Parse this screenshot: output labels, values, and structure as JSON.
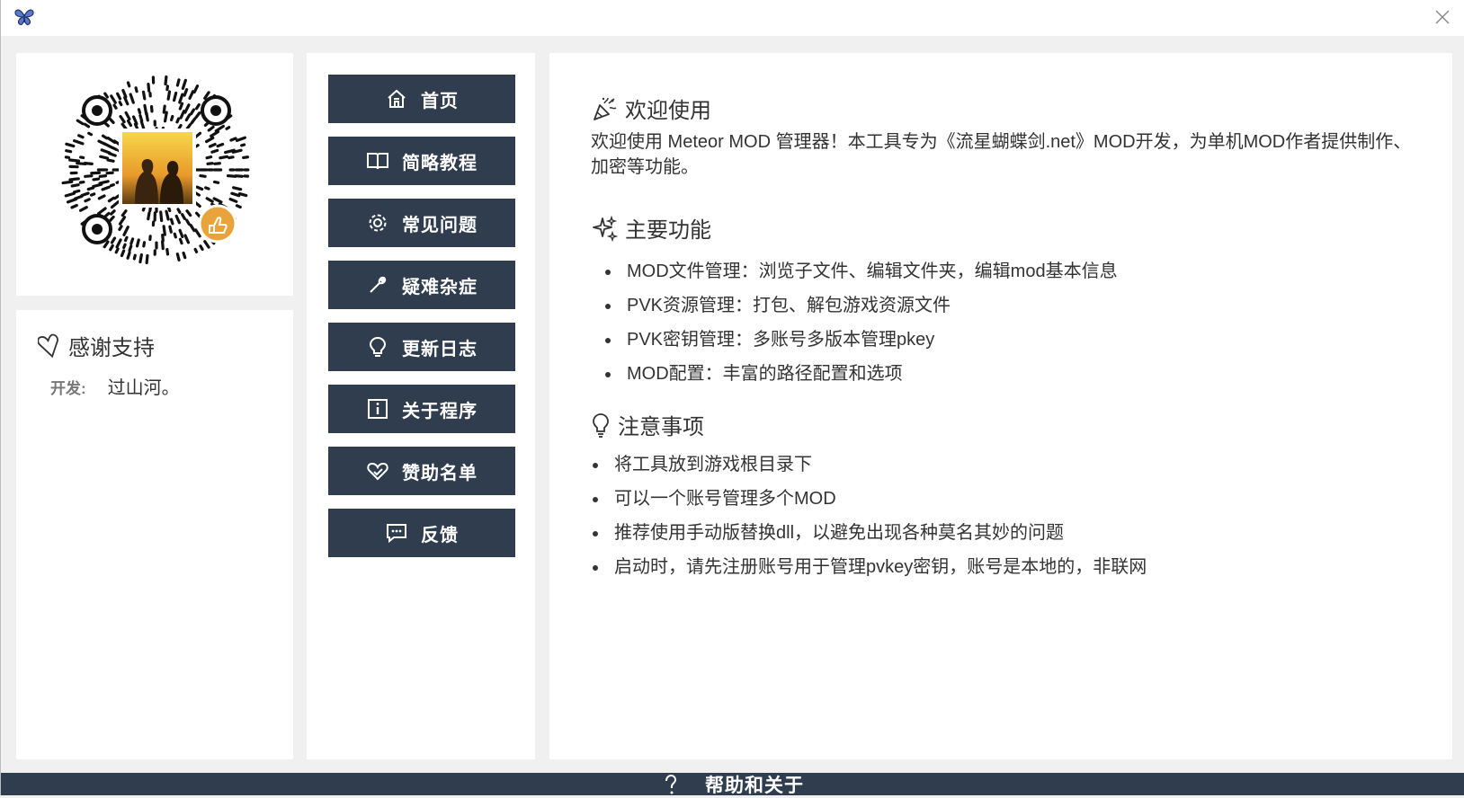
{
  "window": {
    "icons": {
      "app": "butterfly-icon",
      "close": "close-icon"
    }
  },
  "sidebar": {
    "qr": {
      "icon": "qr-code-image"
    },
    "thanks": {
      "title": "感谢支持",
      "icon": "heart-outline-icon",
      "dev_label": "开发:",
      "dev_value": "过山河。"
    }
  },
  "nav": {
    "items": [
      {
        "label": "首页",
        "icon": "home-icon"
      },
      {
        "label": "简略教程",
        "icon": "book-icon"
      },
      {
        "label": "常见问题",
        "icon": "gear-icon"
      },
      {
        "label": "疑难杂症",
        "icon": "wrench-icon"
      },
      {
        "label": "更新日志",
        "icon": "lightbulb-icon"
      },
      {
        "label": "关于程序",
        "icon": "info-icon"
      },
      {
        "label": "赞助名单",
        "icon": "heart-hand-icon"
      },
      {
        "label": "反馈",
        "icon": "chat-icon"
      }
    ]
  },
  "main": {
    "welcome": {
      "title": "欢迎使用",
      "icon": "party-popper-icon",
      "text": "欢迎使用 Meteor MOD 管理器！本工具专为《流星蝴蝶剑.net》MOD开发，为单机MOD作者提供制作、加密等功能。"
    },
    "features": {
      "title": "主要功能",
      "icon": "sparkle-icon",
      "items": [
        "MOD文件管理：浏览子文件、编辑文件夹，编辑mod基本信息",
        "PVK资源管理：打包、解包游戏资源文件",
        "PVK密钥管理：多账号多版本管理pkey",
        "MOD配置：丰富的路径配置和选项"
      ]
    },
    "notes": {
      "title": "注意事项",
      "icon": "lightbulb-icon",
      "items": [
        "将工具放到游戏根目录下",
        "可以一个账号管理多个MOD",
        "推荐使用手动版替换dll，以避免出现各种莫名其妙的问题",
        "启动时，请先注册账号用于管理pvkey密钥，账号是本地的，非联网"
      ]
    }
  },
  "bottombar": {
    "label": "帮助和关于",
    "icon": "question-icon"
  },
  "colors": {
    "nav_bg": "#2f3d4f",
    "page_bg": "#f0f0f0",
    "card_bg": "#ffffff",
    "qr_badge": "#e8a33c"
  }
}
